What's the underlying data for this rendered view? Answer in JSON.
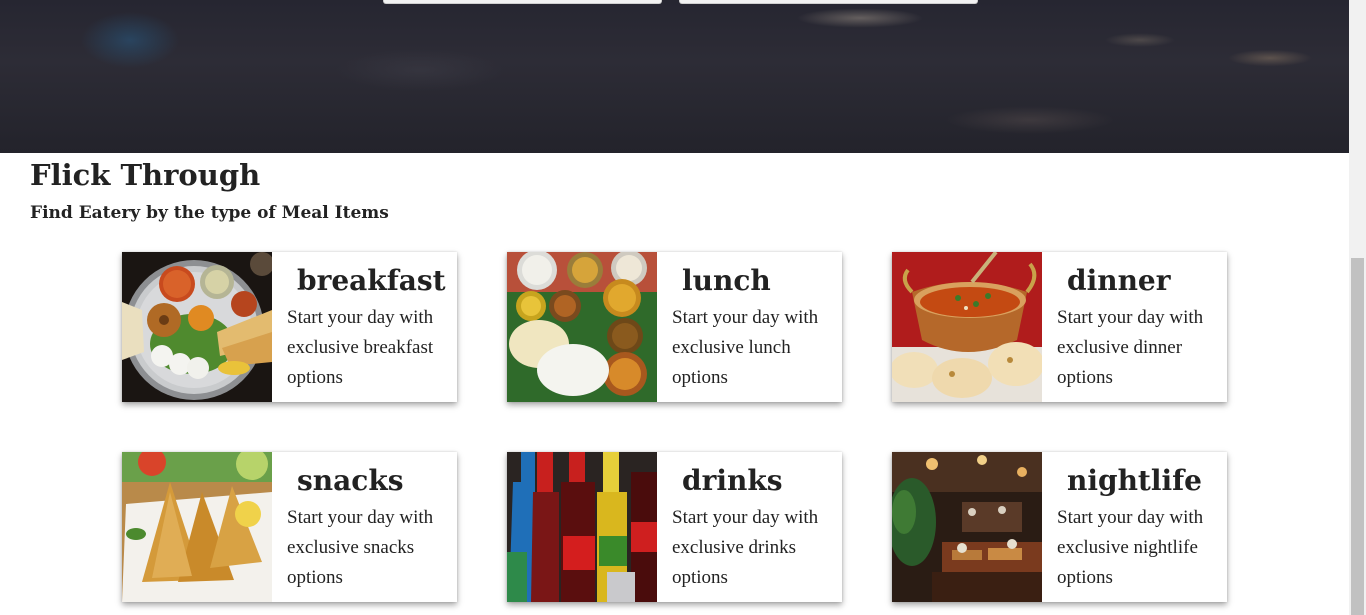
{
  "section": {
    "title": "Flick Through",
    "subtitle": "Find Eatery by the type of Meal Items"
  },
  "cards": [
    {
      "title": "breakfast",
      "description": "Start your day with exclusive breakfast options",
      "image": "south-indian-thali"
    },
    {
      "title": "lunch",
      "description": "Start your day with exclusive lunch options",
      "image": "banana-leaf-meal"
    },
    {
      "title": "dinner",
      "description": "Start your day with exclusive dinner options",
      "image": "curry-with-naan"
    },
    {
      "title": "snacks",
      "description": "Start your day with exclusive snacks options",
      "image": "samosa-plate"
    },
    {
      "title": "drinks",
      "description": "Start your day with exclusive drinks options",
      "image": "soft-drink-bottles"
    },
    {
      "title": "nightlife",
      "description": "Start your day with exclusive nightlife options",
      "image": "restaurant-interior"
    }
  ]
}
